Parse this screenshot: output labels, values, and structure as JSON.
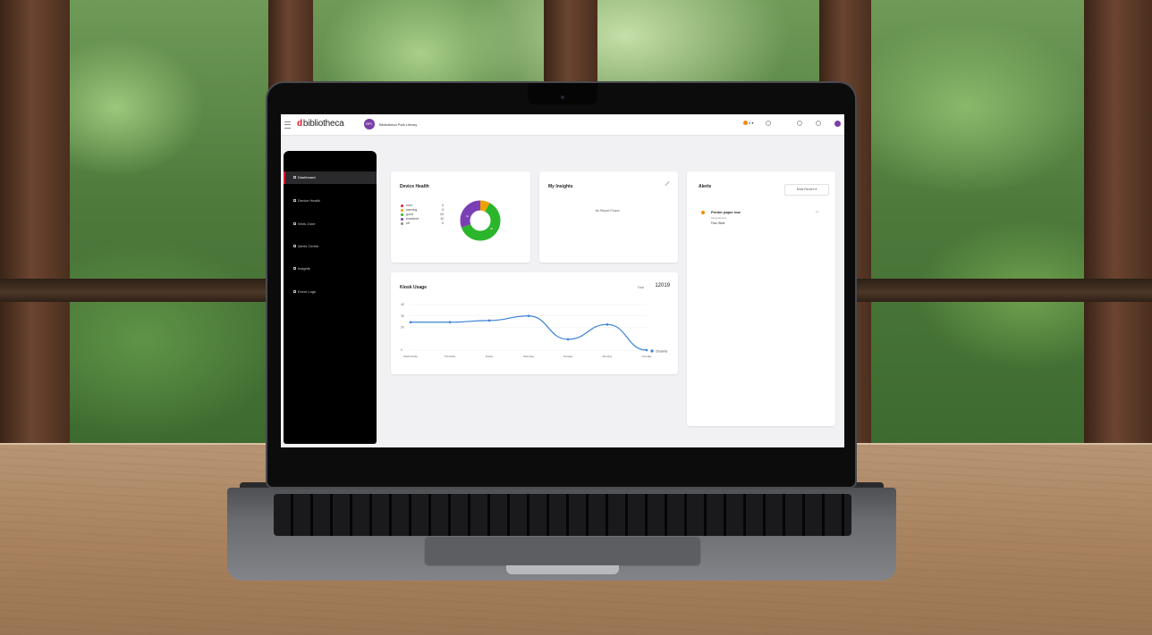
{
  "app": {
    "logo_text": "bibliotheca",
    "logo_mark": "d",
    "library_avatar": "BPL",
    "library_name": "Bibliotheca Park Library",
    "status_count": "4 ▾"
  },
  "sidebar": {
    "items": [
      {
        "label": "Dashboard",
        "icon": "dashboard-icon",
        "active": true
      },
      {
        "label": "Device Health",
        "icon": "health-icon",
        "active": false
      },
      {
        "label": "Work Zone",
        "icon": "workzone-icon",
        "active": false
      },
      {
        "label": "Alerts Centre",
        "icon": "bell-icon",
        "active": false
      },
      {
        "label": "Insights",
        "icon": "insights-icon",
        "active": false
      },
      {
        "label": "Event Logs",
        "icon": "logs-icon",
        "active": false
      }
    ]
  },
  "device_health": {
    "title": "Device Health",
    "legend": [
      {
        "label": "error",
        "value": "0",
        "color": "#e5202e"
      },
      {
        "label": "warning",
        "value": "3",
        "color": "#f0a000"
      },
      {
        "label": "good",
        "value": "24",
        "color": "#2bb52b"
      },
      {
        "label": "excellent",
        "value": "12",
        "color": "#7b3fb5"
      },
      {
        "label": "off",
        "value": "0",
        "color": "#8a8a8a"
      }
    ],
    "donut_labels": [
      "12",
      "24"
    ]
  },
  "insights": {
    "title": "My Insights",
    "empty_text": "No Report Found"
  },
  "alerts": {
    "title": "Alerts",
    "filter_label": "Most Recent ▾",
    "items": [
      {
        "title": "Printer paper low",
        "subtitle": "Kiosk Device",
        "location": "Floor West",
        "time": "1m"
      }
    ]
  },
  "kiosk_usage": {
    "title": "Kiosk Usage",
    "total_label": "Total",
    "total_value": "12019"
  },
  "chart_data": {
    "type": "line",
    "title": "Kiosk Usage",
    "categories": [
      "Wednesday",
      "Thursday",
      "Friday",
      "Saturday",
      "Sunday",
      "Monday",
      "Tuesday"
    ],
    "series": [
      {
        "name": "Checkins",
        "values": [
          2450,
          2450,
          2600,
          3000,
          950,
          2250,
          0
        ]
      }
    ],
    "y_ticks": [
      "4K",
      "3K",
      "2K",
      "0"
    ],
    "ylim": [
      0,
      4000
    ],
    "grid": true,
    "legend": "bottom-right",
    "color": "#3b82d6"
  }
}
